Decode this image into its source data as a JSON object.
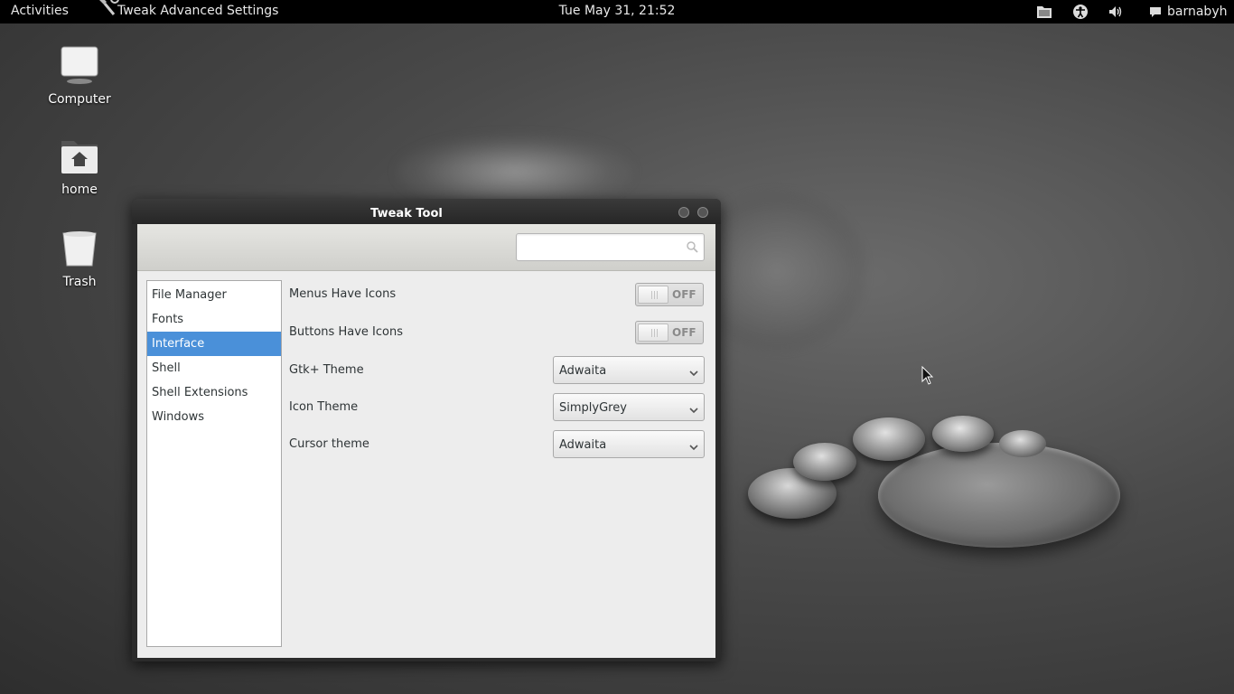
{
  "topbar": {
    "activities": "Activities",
    "app_title": "Tweak Advanced Settings",
    "clock": "Tue May 31, 21:52",
    "username": "barnabyh",
    "tray_icons": [
      "files-icon",
      "accessibility-icon",
      "volume-icon",
      "chat-icon"
    ]
  },
  "desktop": {
    "icons": [
      {
        "label": "Computer",
        "icon": "computer-icon"
      },
      {
        "label": "home",
        "icon": "home-folder-icon"
      },
      {
        "label": "Trash",
        "icon": "trash-icon"
      }
    ]
  },
  "window": {
    "title": "Tweak Tool",
    "search": {
      "value": "",
      "placeholder": "",
      "icon": "search-icon"
    },
    "sidebar": {
      "items": [
        {
          "label": "File Manager",
          "selected": false
        },
        {
          "label": "Fonts",
          "selected": false
        },
        {
          "label": "Interface",
          "selected": true
        },
        {
          "label": "Shell",
          "selected": false
        },
        {
          "label": "Shell Extensions",
          "selected": false
        },
        {
          "label": "Windows",
          "selected": false
        }
      ]
    },
    "settings": {
      "menus_icons": {
        "label": "Menus Have Icons",
        "state": "OFF"
      },
      "buttons_icons": {
        "label": "Buttons Have Icons",
        "state": "OFF"
      },
      "gtk_theme": {
        "label": "Gtk+ Theme",
        "value": "Adwaita"
      },
      "icon_theme": {
        "label": "Icon Theme",
        "value": "SimplyGrey"
      },
      "cursor_theme": {
        "label": "Cursor theme",
        "value": "Adwaita"
      }
    }
  },
  "colors": {
    "selection": "#4a90d9",
    "topbar": "#000000",
    "window_bg": "#ededed"
  }
}
